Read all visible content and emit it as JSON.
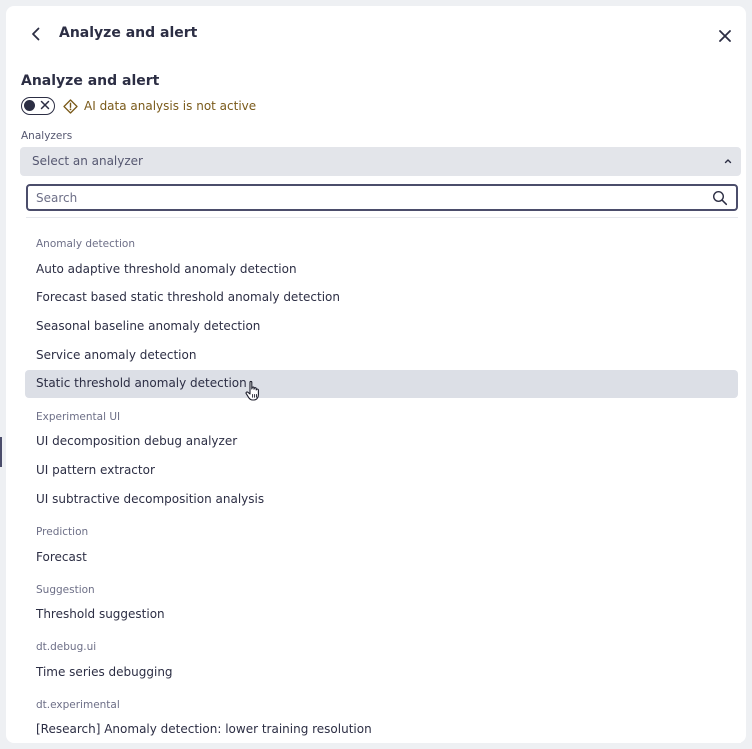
{
  "header": {
    "title": "Analyze and alert"
  },
  "section": {
    "title": "Analyze and alert",
    "ai_status": "AI data analysis is not active"
  },
  "analyzers": {
    "label": "Analyzers",
    "select_placeholder": "Select an analyzer",
    "search_placeholder": "Search",
    "groups": [
      {
        "label": "Anomaly detection",
        "items": [
          "Auto adaptive threshold anomaly detection",
          "Forecast based static threshold anomaly detection",
          "Seasonal baseline anomaly detection",
          "Service anomaly detection",
          "Static threshold anomaly detection"
        ]
      },
      {
        "label": "Experimental UI",
        "items": [
          "UI decomposition debug analyzer",
          "UI pattern extractor",
          "UI subtractive decomposition analysis"
        ]
      },
      {
        "label": "Prediction",
        "items": [
          "Forecast"
        ]
      },
      {
        "label": "Suggestion",
        "items": [
          "Threshold suggestion"
        ]
      },
      {
        "label": "dt.debug.ui",
        "items": [
          "Time series debugging"
        ]
      },
      {
        "label": "dt.experimental",
        "items": [
          "[Research] Anomaly detection: lower training resolution"
        ]
      }
    ]
  },
  "icons": {
    "back": "chevron-left-icon",
    "close": "close-icon",
    "warning": "warning-diamond-icon",
    "search": "search-icon",
    "chevron": "chevron-up-icon",
    "cursor": "hand-pointer-icon"
  },
  "colors": {
    "text": "#2c2e44",
    "warning": "#7a5a1a",
    "hover": "#dcdfe6",
    "select_bg": "#e3e5ea"
  }
}
